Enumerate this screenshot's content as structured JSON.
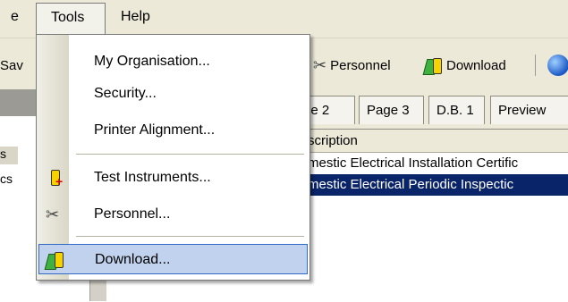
{
  "menubar": {
    "items": [
      {
        "label": "e"
      },
      {
        "label": "Tools"
      },
      {
        "label": "Help"
      }
    ]
  },
  "toolbar": {
    "save_partial": "Sav",
    "personnel_label": "Personnel",
    "download_label": "Download"
  },
  "left_strip": {
    "s_label": "s",
    "cs_label": "cs"
  },
  "tabs": [
    {
      "label": "ge 2"
    },
    {
      "label": "Page 3"
    },
    {
      "label": "D.B. 1"
    },
    {
      "label": "Preview"
    }
  ],
  "grid": {
    "header": "scription",
    "rows": [
      {
        "text": "mestic Electrical Installation Certific"
      },
      {
        "text": "mestic Electrical Periodic Inspectic"
      }
    ]
  },
  "dropdown": {
    "items": [
      {
        "label": "My Organisation...",
        "icon": "none"
      },
      {
        "label": "Security...",
        "icon": "none"
      },
      {
        "label": "Printer Alignment...",
        "icon": "none"
      },
      {
        "label": "Test Instruments...",
        "icon": "test-instrument-icon"
      },
      {
        "label": "Personnel...",
        "icon": "personnel-icon"
      },
      {
        "label": "Download...",
        "icon": "download-icon"
      }
    ]
  },
  "colors": {
    "selection_highlight": "#0a246a",
    "menu_hover": "#c1d2ee",
    "menu_hover_border": "#316ac5"
  }
}
